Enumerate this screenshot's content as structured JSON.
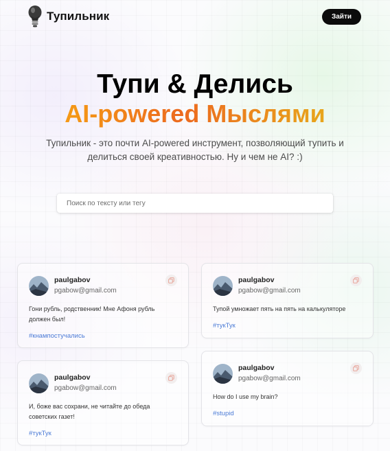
{
  "header": {
    "brand": "Тупильник",
    "login_label": "Зайти",
    "logo_icon": "lightbulb-icon"
  },
  "hero": {
    "title": "Тупи & Делись",
    "accent": "AI-powered Мыслями",
    "description": "Тупильник - это почти AI-powered инструмент, позволяющий тупить и делиться своей креативностью. Ну и чем не AI? :)"
  },
  "search": {
    "placeholder": "Поиск по тексту или тегу",
    "value": ""
  },
  "posts": [
    {
      "username": "paulgabov",
      "email": "pgabow@gmail.com",
      "text": "Гони рубль, родственник! Мне Афоня рубль должен был!",
      "tag": "#кнампостучались"
    },
    {
      "username": "paulgabov",
      "email": "pgabow@gmail.com",
      "text": "И, боже вас сохрани, не читайте до обеда советских газет!",
      "tag": "#тукТук"
    },
    {
      "username": "paulgabov",
      "email": "pgabow@gmail.com",
      "text": "Тупой умножает пять на пять на калькуляторе",
      "tag": "#тукТук"
    },
    {
      "username": "paulgabov",
      "email": "pgabow@gmail.com",
      "text": "How do I use my brain?",
      "tag": "#stupid"
    }
  ],
  "colors": {
    "accent_start": "#f59a15",
    "accent_end": "#e8a61b",
    "tag": "#4b7bd6",
    "button_bg": "#0b0b0b"
  }
}
